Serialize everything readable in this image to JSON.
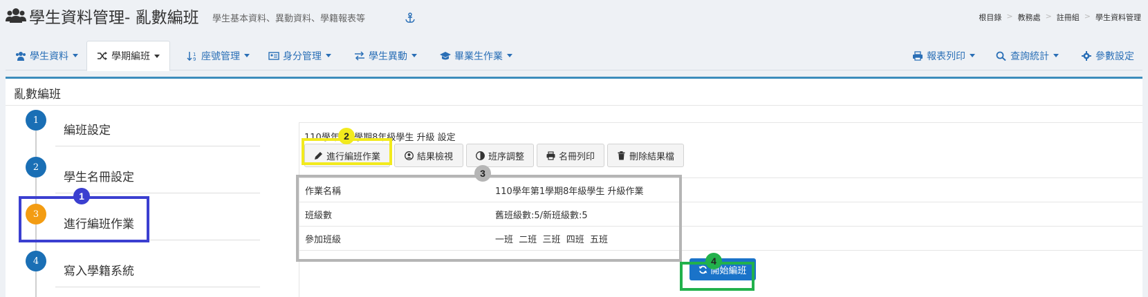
{
  "header": {
    "title": "學生資料管理- 亂數編班",
    "subtitle": "學生基本資料、異動資料、學籍報表等",
    "breadcrumb": [
      "根目錄",
      "教務處",
      "註冊組",
      "學生資料管理"
    ]
  },
  "nav": {
    "left": [
      {
        "label": "學生資料",
        "icon": "users-icon"
      },
      {
        "label": "學期編班",
        "icon": "shuffle-icon",
        "active": true
      },
      {
        "label": "座號管理",
        "icon": "sort-numeric-icon"
      },
      {
        "label": "身分管理",
        "icon": "id-card-icon"
      },
      {
        "label": "學生異動",
        "icon": "exchange-icon"
      },
      {
        "label": "畢業生作業",
        "icon": "graduation-cap-icon"
      }
    ],
    "right": [
      {
        "label": "報表列印",
        "icon": "print-icon"
      },
      {
        "label": "查詢統計",
        "icon": "search-icon"
      },
      {
        "label": "參數設定",
        "icon": "gear-icon"
      }
    ]
  },
  "panel": {
    "title": "亂數編班"
  },
  "steps": [
    {
      "number": "1",
      "label": "編班設定",
      "state": "done",
      "color": "#1a6fb5"
    },
    {
      "number": "2",
      "label": "學生名冊設定",
      "state": "done",
      "color": "#1a6fb5"
    },
    {
      "number": "3",
      "label": "進行編班作業",
      "state": "current",
      "color": "#f39c12"
    },
    {
      "number": "4",
      "label": "寫入學籍系統",
      "state": "pending",
      "color": "#1a6fb5"
    }
  ],
  "content": {
    "heading": "110學年第1學期8年級學生 升級 設定",
    "buttons": [
      {
        "label": "進行編班作業",
        "icon": "pencil-icon"
      },
      {
        "label": "結果檢視",
        "icon": "user-circle-icon"
      },
      {
        "label": "班序調整",
        "icon": "adjust-icon"
      },
      {
        "label": "名冊列印",
        "icon": "print-icon"
      },
      {
        "label": "刪除結果檔",
        "icon": "trash-icon"
      }
    ],
    "table": [
      {
        "key": "作業名稱",
        "value": "110學年第1學期8年級學生 升級作業"
      },
      {
        "key": "班級數",
        "value": "舊班級數:5/新班級數:5"
      },
      {
        "key": "參加班級",
        "value": "一班  二班  三班  四班  五班"
      }
    ],
    "start_button": "開始編班"
  },
  "annotations": [
    {
      "label": "1",
      "color": "#3b3fd0"
    },
    {
      "label": "2",
      "color": "#f2ea1d"
    },
    {
      "label": "3",
      "color": "#b5b5b5"
    },
    {
      "label": "4",
      "color": "#22b14c"
    }
  ]
}
